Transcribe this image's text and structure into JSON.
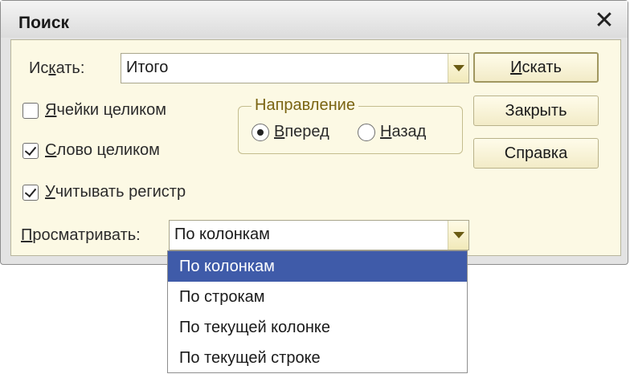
{
  "window": {
    "title": "Поиск"
  },
  "search": {
    "label_pre": "Ис",
    "label_key": "к",
    "label_post": "ать:",
    "value": "Итого"
  },
  "options": {
    "whole_cell": {
      "key": "Я",
      "rest": "чейки целиком",
      "checked": false
    },
    "whole_word": {
      "key": "С",
      "rest": "лово целиком",
      "checked": true
    },
    "match_case": {
      "key": "У",
      "rest": "читывать регистр",
      "checked": true
    }
  },
  "direction": {
    "title": "Направление",
    "forward": {
      "key": "В",
      "rest": "перед",
      "selected": true
    },
    "backward": {
      "key": "Н",
      "rest": "азад",
      "selected": false
    }
  },
  "browse": {
    "label_key": "П",
    "label_rest": "росматривать:",
    "value": "По колонкам",
    "options": [
      "По колонкам",
      "По строкам",
      "По текущей колонке",
      "По текущей строке"
    ],
    "selected_index": 0
  },
  "buttons": {
    "find_key": "И",
    "find_rest": "скать",
    "close": "Закрыть",
    "help": "Справка"
  },
  "colors": {
    "panel_bg": "#fcf9e4",
    "selection": "#3f5ba9",
    "group_title": "#7a6412"
  },
  "icons": {
    "close": "close-icon",
    "dropdown": "chevron-down-icon"
  }
}
